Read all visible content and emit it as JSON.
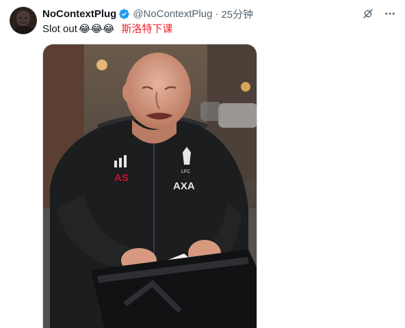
{
  "author": {
    "display_name": "NoContextPlug",
    "handle": "@NoContextPlug",
    "separator": "·",
    "time_ago": "25分钟",
    "avatar_icon": "avatar-photo",
    "verified_icon": "verified-badge-icon",
    "verified_color": "#1d9bf0"
  },
  "tweet": {
    "text": "Slot out",
    "emojis": "😂😂😂",
    "translate_label": "斯洛特下课",
    "translate_color": "#f4212e"
  },
  "actions": {
    "grok_icon": "grok-icon",
    "more_icon": "more-options-icon"
  },
  "media": {
    "type": "photo",
    "jacket_initials": "AS",
    "jacket_crest": "LFC",
    "jacket_sponsor": "AXA"
  },
  "colors": {
    "text_primary": "#0f1419",
    "text_secondary": "#536471",
    "border": "#cfd9de"
  }
}
